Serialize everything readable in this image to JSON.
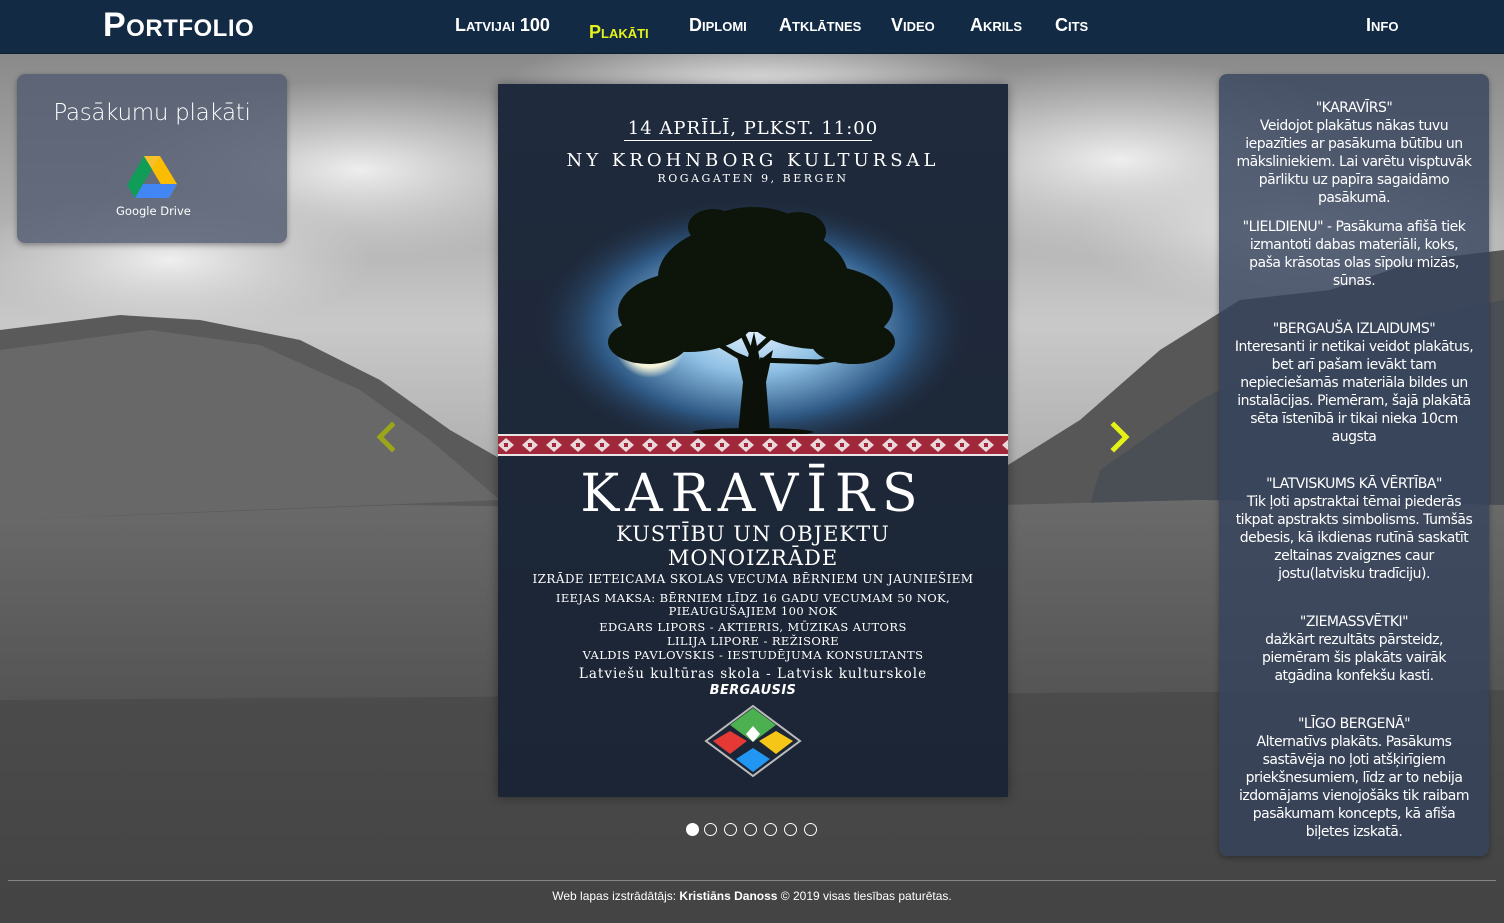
{
  "navbar": {
    "brand": "Portfolio",
    "items": [
      {
        "label": "Latvijai 100",
        "active": false
      },
      {
        "label": "Plakāti",
        "active": true
      },
      {
        "label": "Diplomi",
        "active": false
      },
      {
        "label": "Atklātnes",
        "active": false
      },
      {
        "label": "Video",
        "active": false
      },
      {
        "label": "Akrils",
        "active": false
      },
      {
        "label": "Cits",
        "active": false
      }
    ],
    "info": "Info",
    "active_color": "#e4f218",
    "background_color": "#132a44"
  },
  "left_panel": {
    "title": "Pasākumu plakāti",
    "drive_label": "Google Drive",
    "drive_icon": "google-drive-icon"
  },
  "poster": {
    "date": "14 APRĪLĪ, PLKST. 11:00",
    "venue": "NY KROHNBORG KULTURSAL",
    "address": "ROGAGATEN 9, BERGEN",
    "title": "KARAVĪRS",
    "subtitle1": "KUSTĪBU UN OBJEKTU",
    "subtitle2": "MONOIZRĀDE",
    "lines": [
      "IZRĀDE IETEICAMA SKOLAS VECUMA BĒRNIEM UN JAUNIEŠIEM",
      "IEEJAS MAKSA: BĒRNIEM LĪDZ 16 GADU VECUMAM 50 NOK,",
      "PIEAUGUŠAJIEM 100 NOK",
      "EDGARS LIPORS - AKTIERIS, MŪZIKAS AUTORS",
      "LILIJA LIPORE - REŽISORE",
      "VALDIS PAVLOVSKIS - IESTUDĒJUMA KONSULTANTS",
      "Latviešu kultūras skola - Latvisk kulturskole",
      "BERGAUSIS"
    ]
  },
  "carousel": {
    "prev_icon": "chevron-left-icon",
    "next_icon": "chevron-right-icon",
    "arrow_color": "#e4f218",
    "slide_count": 7,
    "active_slide": 1
  },
  "right_panel": {
    "blocks": [
      {
        "title": "\"KARAVĪRS\"",
        "text": "Veidojot plakātus nākas tuvu iepazīties ar pasākuma būtību un māksliniekiem. Lai varētu visptuvāk pārliktu uz papīra sagaidāmo pasākumā."
      },
      {
        "title": "",
        "text": "\"LIELDIENU\" - Pasākuma afišā tiek izmantoti dabas materiāli, koks, paša krāsotas olas sīpolu mizās, sūnas."
      },
      {
        "title": "\"BERGAUŠA IZLAIDUMS\"",
        "text": "Interesanti ir netikai veidot plakātus, bet arī pašam ievākt tam nepieciešamās materiāla bildes un instalācijas. Piemēram, šajā plakātā sēta īstenībā ir tikai nieka 10cm augsta"
      },
      {
        "title": "\"LATVISKUMS KĀ VĒRTĪBA\"",
        "text": "Tik ļoti apstraktai tēmai piederās tikpat apstrakts simbolisms. Tumšās debesis, kā ikdienas rutīnā saskatīt zeltainas zvaigznes caur jostu(latvisku tradīciju)."
      },
      {
        "title": "\"ZIEMASSVĒTKI\"",
        "text": "dažkārt rezultāts pārsteidz, piemēram šis plakāts vairāk atgādina konfekšu kasti."
      },
      {
        "title": "\"LĪGO BERGENĀ\"",
        "text": "Alternatīvs plakāts. Pasākums sastāvēja no ļoti atšķirīgiem priekšnesumiem, līdz ar to nebija izdomājams vienojošāks tik raibam pasākumam koncepts, kā afiša biļetes izskatā."
      }
    ]
  },
  "footer": {
    "prefix": "Web lapas izstrādātājs: ",
    "author": "Kristiāns Danoss",
    "suffix": " © 2019 visas tiesības paturētas."
  }
}
